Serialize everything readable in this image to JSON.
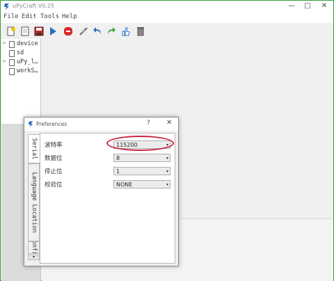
{
  "window": {
    "title": "uPyCraft V0.25",
    "minimize": "—",
    "maximize": "□",
    "close": "✕"
  },
  "menu": [
    "File",
    "Edit",
    "Tools",
    "Help"
  ],
  "toolbar": {
    "icons": [
      "new-file-icon",
      "open-file-icon",
      "save-icon",
      "download-run-icon",
      "stop-icon",
      "connect-icon",
      "undo-icon",
      "redo-icon",
      "syntax-check-icon",
      "clear-icon"
    ]
  },
  "tree": {
    "items": [
      {
        "label": "device",
        "expandable": true
      },
      {
        "label": "sd",
        "expandable": false
      },
      {
        "label": "uPy_l…",
        "expandable": true
      },
      {
        "label": "workS…",
        "expandable": false
      }
    ]
  },
  "dialog": {
    "title": "Preferences",
    "help": "?",
    "close": "✕",
    "tabs": [
      "Serial",
      "Language Location",
      "Config"
    ],
    "active_tab": "Serial",
    "scroll_arrow": "▾",
    "fields": [
      {
        "label": "波特率",
        "value": "115200"
      },
      {
        "label": "数据位",
        "value": "8"
      },
      {
        "label": "停止位",
        "value": "1"
      },
      {
        "label": "校验位",
        "value": "NONE"
      }
    ],
    "dropdown_arrow": "▾"
  },
  "colors": {
    "frame": "#2f9e3a",
    "highlight": "#c8213a"
  }
}
